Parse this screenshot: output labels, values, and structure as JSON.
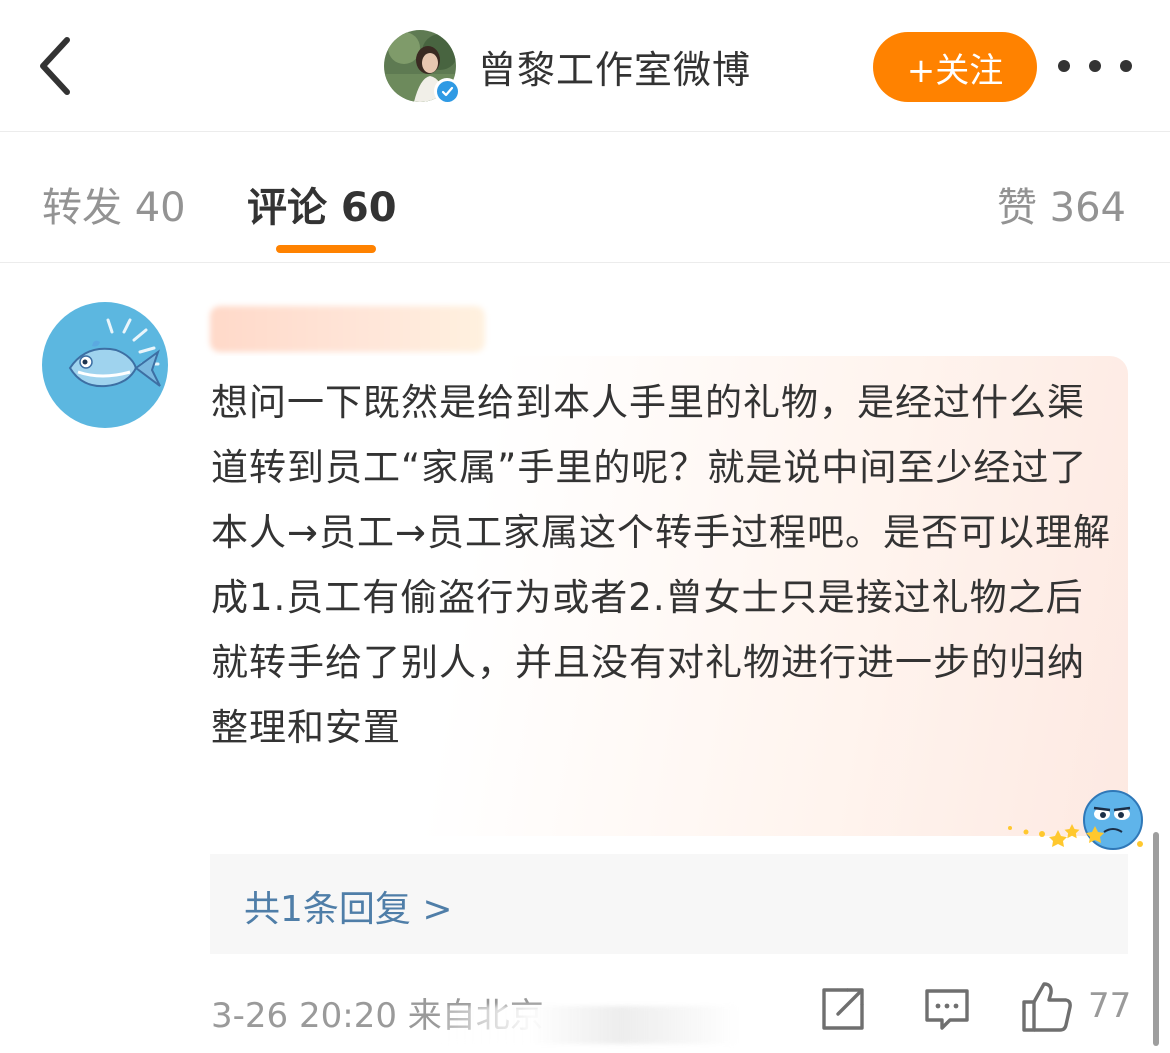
{
  "header": {
    "title": "曾黎工作室微博",
    "follow_label": "+关注"
  },
  "tabs": {
    "repost": "转发 40",
    "comment": "评论 60",
    "like": "赞 364"
  },
  "comment": {
    "author": "",
    "text": "想问一下既然是给到本人手里的礼物，是经过什么渠道转到员工“家属”手里的呢？就是说中间至少经过了本人→员工→员工家属这个转手过程吧。是否可以理解成1.员工有偷盗行为或者2.曾女士只是接过礼物之后就转手给了别人，并且没有对礼物进行进一步的归纳整理和安置",
    "replies_link": "共1条回复 >",
    "meta": "3-26 20:20 来自北京",
    "like_count": "77"
  },
  "colors": {
    "accent": "#ff8200",
    "link": "#4f7ea8",
    "verified": "#2f9ae4"
  },
  "icons": [
    "back-arrow-icon",
    "verified-icon",
    "more-icon",
    "fish-icon",
    "sticker-icon",
    "share-icon",
    "comment-icon",
    "thumbs-up-icon"
  ]
}
